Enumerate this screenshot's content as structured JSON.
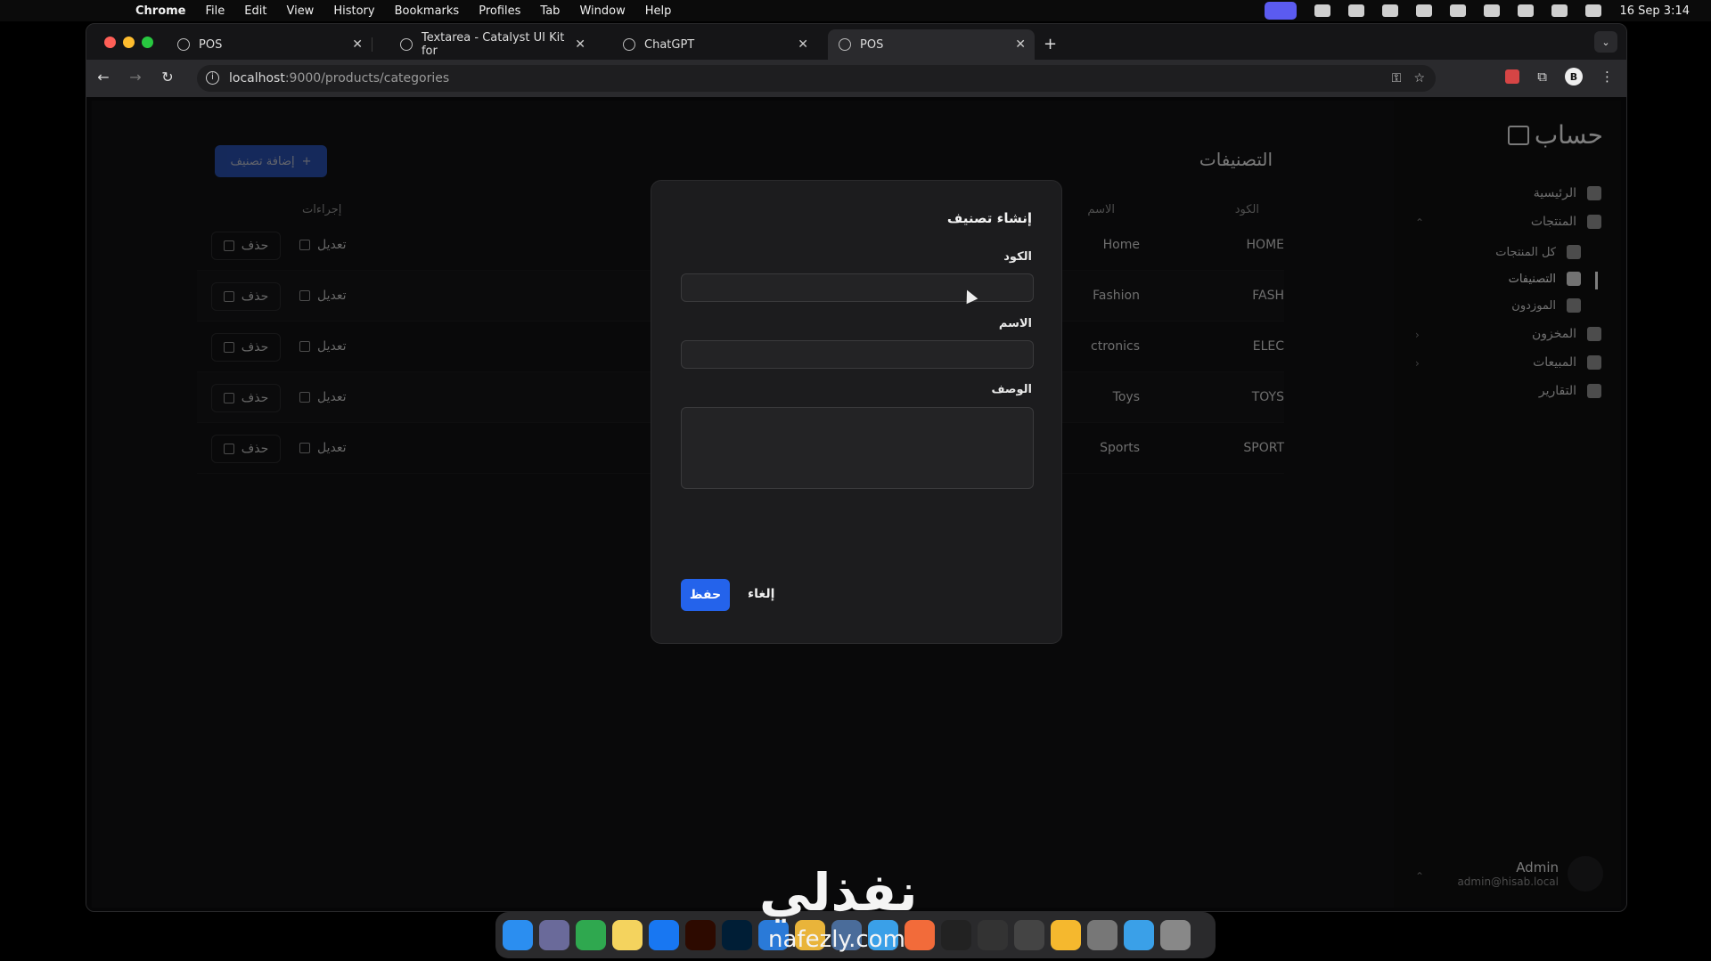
{
  "menubar": {
    "app": "Chrome",
    "items": [
      "File",
      "Edit",
      "View",
      "History",
      "Bookmarks",
      "Profiles",
      "Tab",
      "Window",
      "Help"
    ],
    "datetime": "16 Sep  3:14"
  },
  "browser": {
    "tabs": [
      {
        "title": "POS"
      },
      {
        "title": "Textarea - Catalyst UI Kit for"
      },
      {
        "title": "ChatGPT"
      },
      {
        "title": "POS"
      }
    ],
    "url_host": "localhost",
    "url_rest": ":9000/products/categories",
    "profile_initial": "B"
  },
  "page": {
    "title": "التصنيفات",
    "add_button": "إضافة تصنيف",
    "columns": {
      "code": "الكود",
      "name": "الاسم",
      "actions": "إجراءات"
    },
    "rows": [
      {
        "code": "HOME",
        "name": "Home",
        "edit": "تعديل",
        "delete": "حذف"
      },
      {
        "code": "FASH",
        "name": "Fashion",
        "edit": "تعديل",
        "delete": "حذف"
      },
      {
        "code": "ELEC",
        "name": "ctronics",
        "edit": "تعديل",
        "delete": "حذف"
      },
      {
        "code": "TOYS",
        "name": "Toys",
        "edit": "تعديل",
        "delete": "حذف"
      },
      {
        "code": "SPORT",
        "name": "Sports",
        "edit": "تعديل",
        "delete": "حذف"
      }
    ]
  },
  "modal": {
    "title": "إنشاء تصنيف",
    "code_label": "الكود",
    "name_label": "الاسم",
    "description_label": "الوصف",
    "code_value": "",
    "name_value": "",
    "description_value": "",
    "save": "حفظ",
    "cancel": "إلغاء"
  },
  "sidebar": {
    "brand": "حساب",
    "items": [
      {
        "label": "الرئيسية",
        "icon": "home-icon"
      },
      {
        "label": "المنتجات",
        "icon": "box-icon"
      },
      {
        "label": "كل المنتجات",
        "icon": "grid-icon"
      },
      {
        "label": "التصنيفات",
        "icon": "tag-icon"
      },
      {
        "label": "الموزدون",
        "icon": "suppliers-icon"
      },
      {
        "label": "المخزون",
        "icon": "users-icon"
      },
      {
        "label": "المبيعات",
        "icon": "gear-icon"
      },
      {
        "label": "التقارير",
        "icon": "bar-chart-icon"
      }
    ],
    "user": {
      "name": "Admin",
      "email": "admin@hisab.local"
    }
  },
  "watermark": {
    "text": "نفذلي",
    "domain": "nafezly.com"
  }
}
